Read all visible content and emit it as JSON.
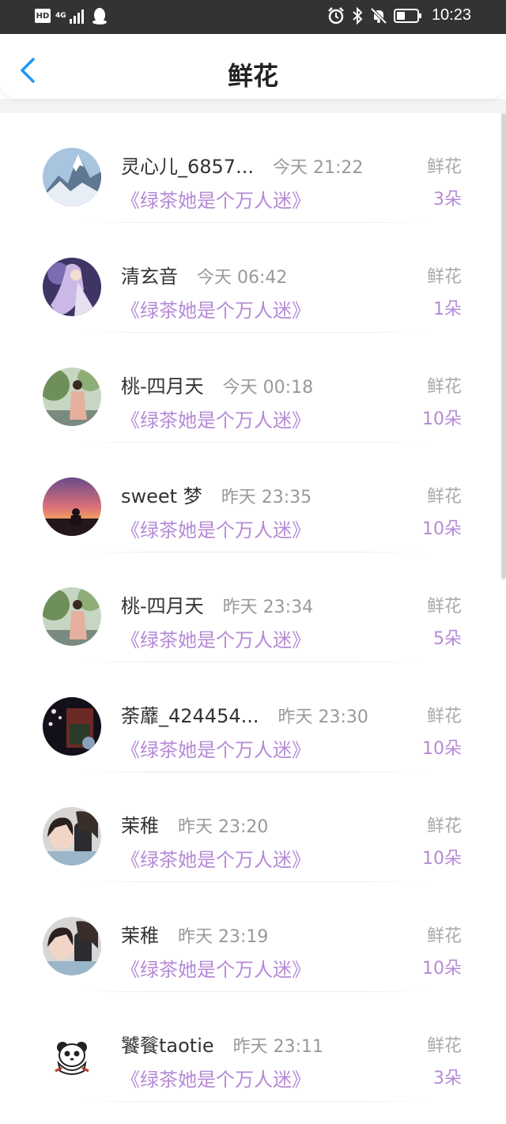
{
  "status_bar": {
    "left_badge": "HD",
    "network": "4G",
    "time": "10:23"
  },
  "header": {
    "title": "鲜花"
  },
  "gift": {
    "label": "鲜花"
  },
  "items": [
    {
      "name": "灵心儿_6857...",
      "time": "今天 21:22",
      "book": "《绿茶她是个万人迷》",
      "count": "3朵",
      "avatar": "mountain"
    },
    {
      "name": "清玄音",
      "time": "今天 06:42",
      "book": "《绿茶她是个万人迷》",
      "count": "1朵",
      "avatar": "anime"
    },
    {
      "name": "桃-四月天",
      "time": "今天 00:18",
      "book": "《绿茶她是个万人迷》",
      "count": "10朵",
      "avatar": "girl-tree"
    },
    {
      "name": "sweet 梦",
      "time": "昨天 23:35",
      "book": "《绿茶她是个万人迷》",
      "count": "10朵",
      "avatar": "sunset"
    },
    {
      "name": "桃-四月天",
      "time": "昨天 23:34",
      "book": "《绿茶她是个万人迷》",
      "count": "5朵",
      "avatar": "girl-tree"
    },
    {
      "name": "荼蘼_424454...",
      "time": "昨天 23:30",
      "book": "《绿茶她是个万人迷》",
      "count": "10朵",
      "avatar": "night"
    },
    {
      "name": "茉稚",
      "time": "昨天 23:20",
      "book": "《绿茶她是个万人迷》",
      "count": "10朵",
      "avatar": "selfie"
    },
    {
      "name": "茉稚",
      "time": "昨天 23:19",
      "book": "《绿茶她是个万人迷》",
      "count": "10朵",
      "avatar": "selfie"
    },
    {
      "name": "饕餮taotie",
      "time": "昨天 23:11",
      "book": "《绿茶她是个万人迷》",
      "count": "3朵",
      "avatar": "panda"
    }
  ],
  "colors": {
    "accent": "#2196f3",
    "book_title": "#b58ad6",
    "status_bar": "#333333"
  }
}
